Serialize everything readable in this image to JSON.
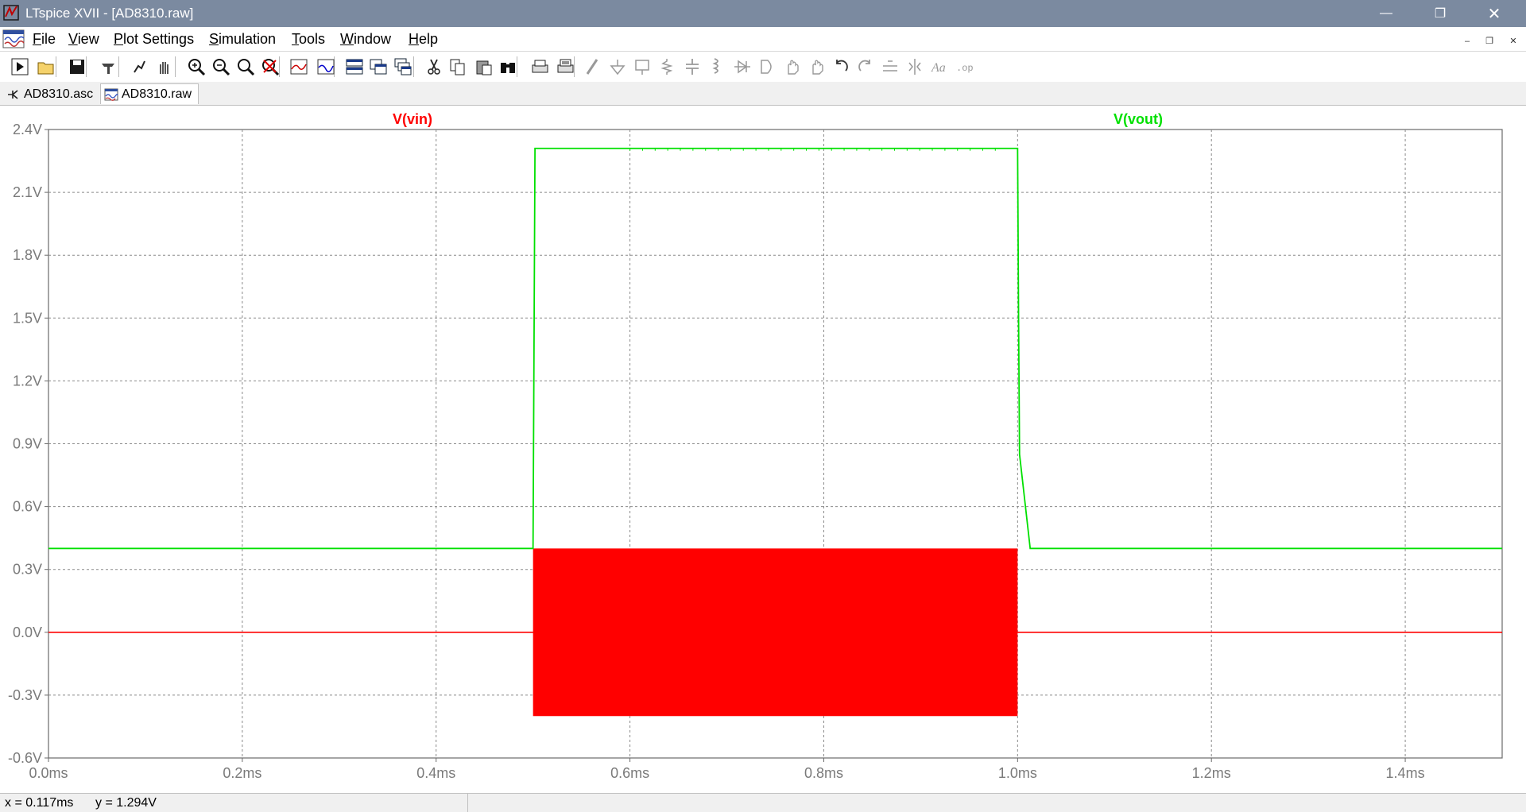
{
  "window": {
    "title": "LTspice XVII - [AD8310.raw]",
    "min_glyph": "—",
    "max_glyph": "❐",
    "close_glyph": "✕"
  },
  "menu": {
    "items": [
      {
        "label": "File",
        "accel": "F"
      },
      {
        "label": "View",
        "accel": "V"
      },
      {
        "label": "Plot Settings",
        "accel": "P"
      },
      {
        "label": "Simulation",
        "accel": "S"
      },
      {
        "label": "Tools",
        "accel": "T"
      },
      {
        "label": "Window",
        "accel": "W"
      },
      {
        "label": "Help",
        "accel": "H"
      }
    ],
    "mdi_min": "–",
    "mdi_restore": "❐",
    "mdi_close": "✕"
  },
  "toolbar": {
    "icons": [
      "run-icon",
      "open-icon",
      "save-icon",
      "control-panel-icon",
      "halt-icon",
      "pan-icon",
      "zoom-in-icon",
      "zoom-out-icon",
      "zoom-extent-icon",
      "zoom-cancel-icon",
      "autorange-icon",
      "mark-unref-icon",
      "tile-horizontal-icon",
      "tile-vertical-icon",
      "cascade-icon",
      "cut-icon",
      "copy-icon",
      "paste-icon",
      "find-icon",
      "print-icon",
      "print-setup-icon",
      "wire-icon",
      "ground-icon",
      "label-icon",
      "resistor-icon",
      "capacitor-icon",
      "inductor-icon",
      "diode-icon",
      "component-icon",
      "move-icon",
      "drag-icon",
      "undo-icon",
      "redo-icon",
      "rotate-icon",
      "mirror-icon",
      "text-icon",
      "spice-directive-icon"
    ]
  },
  "tabs": [
    {
      "label": "AD8310.asc",
      "icon": "schematic-icon",
      "active": false
    },
    {
      "label": "AD8310.raw",
      "icon": "waveform-icon",
      "active": true
    }
  ],
  "chart_data": {
    "type": "line",
    "xlabel": "",
    "ylabel": "",
    "xlim": [
      0.0,
      1.5
    ],
    "ylim": [
      -0.6,
      2.4
    ],
    "x_ticks": [
      "0.0ms",
      "0.2ms",
      "0.4ms",
      "0.6ms",
      "0.8ms",
      "1.0ms",
      "1.2ms",
      "1.4ms"
    ],
    "x_tick_values": [
      0.0,
      0.2,
      0.4,
      0.6,
      0.8,
      1.0,
      1.2,
      1.4
    ],
    "y_ticks": [
      "2.4V",
      "2.1V",
      "1.8V",
      "1.5V",
      "1.2V",
      "0.9V",
      "0.6V",
      "0.3V",
      "0.0V",
      "-0.3V",
      "-0.6V"
    ],
    "y_tick_values": [
      2.4,
      2.1,
      1.8,
      1.5,
      1.2,
      0.9,
      0.6,
      0.3,
      0.0,
      -0.3,
      -0.6
    ],
    "grid": true,
    "series": [
      {
        "name": "V(vin)",
        "color": "#ff0000",
        "style": "burst",
        "x": [
          0.0,
          0.5,
          0.5,
          1.0,
          1.0,
          1.5
        ],
        "y": [
          0.0,
          0.0,
          0.0,
          0.0,
          0.0,
          0.0
        ],
        "burst": {
          "x_start": 0.5,
          "x_end": 1.0,
          "y_min": -0.4,
          "y_max": 0.4
        }
      },
      {
        "name": "V(vout)",
        "color": "#00e000",
        "style": "line",
        "x": [
          0.0,
          0.5,
          0.502,
          1.0,
          1.001,
          1.002,
          1.013,
          1.5
        ],
        "y": [
          0.4,
          0.4,
          2.31,
          2.31,
          1.5,
          0.85,
          0.4,
          0.4
        ]
      }
    ]
  },
  "status": {
    "x_readout": "x = 0.117ms",
    "y_readout": "y = 1.294V"
  }
}
